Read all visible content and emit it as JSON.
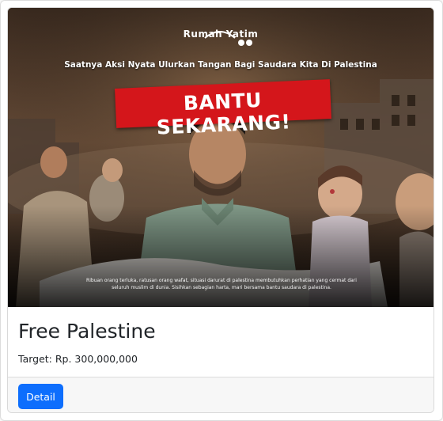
{
  "card": {
    "banner": {
      "logo_text": "Rumah Yatim",
      "tagline": "Saatnya Aksi Nyata Ulurkan Tangan Bagi Saudara Kita Di Palestina",
      "cta": "BANTU SEKARANG!",
      "caption": "Ribuan orang terluka, ratusan orang wafat, situasi darurat di palestina membutuhkan perhatian yang cermat dari seluruh muslim di dunia. Sisihkan sebagian harta, mari bersama bantu saudara di palestina."
    },
    "title": "Free Palestine",
    "target_text": "Target: Rp. 300,000,000",
    "detail_button": "Detail"
  },
  "colors": {
    "cta_red": "#d4161b",
    "button_blue": "#0d6efd",
    "footer_bg": "#f7f7f7",
    "text_dark": "#212529"
  }
}
